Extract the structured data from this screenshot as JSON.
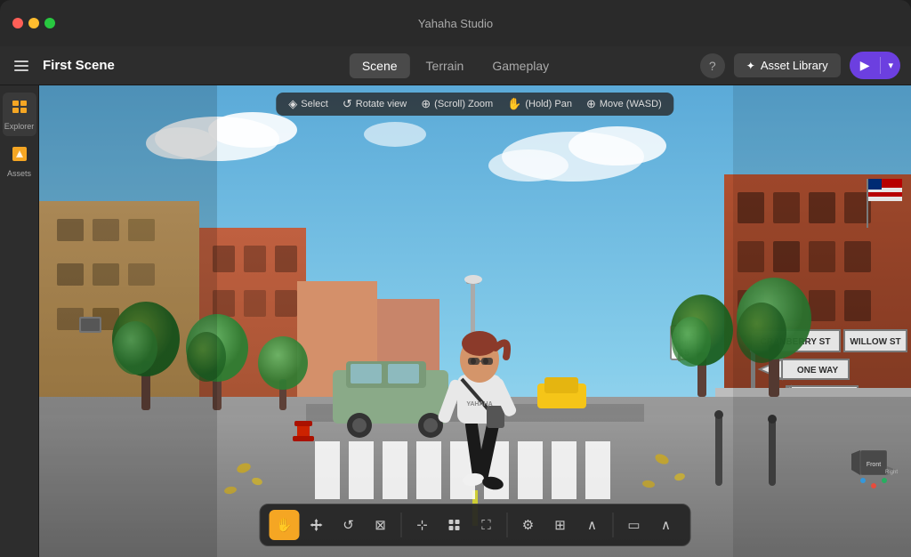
{
  "app": {
    "title": "Yahaha Studio"
  },
  "title_bar": {
    "traffic_lights": [
      "red",
      "yellow",
      "green"
    ]
  },
  "toolbar": {
    "scene_name": "First Scene",
    "tabs": [
      {
        "id": "scene",
        "label": "Scene",
        "active": true
      },
      {
        "id": "terrain",
        "label": "Terrain",
        "active": false
      },
      {
        "id": "gameplay",
        "label": "Gameplay",
        "active": false
      }
    ],
    "help_label": "?",
    "asset_library_label": "Asset Library",
    "play_label": "▶",
    "play_dropdown": "▾"
  },
  "sidebar": {
    "items": [
      {
        "id": "explorer",
        "label": "Explorer",
        "icon": "🗂"
      },
      {
        "id": "assets",
        "label": "Assets",
        "icon": "🟧"
      }
    ]
  },
  "viewport_toolbar": {
    "tools": [
      {
        "id": "select",
        "icon": "◈",
        "label": "Select"
      },
      {
        "id": "rotate",
        "icon": "↺",
        "label": "Rotate view"
      },
      {
        "id": "zoom",
        "icon": "⊕",
        "label": "(Scroll) Zoom"
      },
      {
        "id": "pan",
        "icon": "✋",
        "label": "(Hold) Pan"
      },
      {
        "id": "move",
        "icon": "⊕",
        "label": "Move (WASD)"
      }
    ]
  },
  "bottom_toolbar": {
    "buttons": [
      {
        "id": "hand",
        "icon": "✋",
        "active": true,
        "label": "Hand tool"
      },
      {
        "id": "move",
        "icon": "✛",
        "active": false,
        "label": "Move"
      },
      {
        "id": "rotate2",
        "icon": "↺",
        "active": false,
        "label": "Rotate"
      },
      {
        "id": "scale",
        "icon": "⊠",
        "active": false,
        "label": "Scale"
      },
      {
        "id": "transform",
        "icon": "⊹",
        "active": false,
        "label": "Transform"
      },
      {
        "id": "pivot",
        "icon": "⊕",
        "active": false,
        "label": "Pivot"
      },
      {
        "id": "expand",
        "icon": "⛶",
        "active": false,
        "label": "Expand"
      },
      {
        "id": "settings",
        "icon": "⚙",
        "active": false,
        "label": "Settings"
      },
      {
        "id": "grid",
        "icon": "⊞",
        "active": false,
        "label": "Grid"
      },
      {
        "id": "chevup",
        "icon": "∧",
        "active": false,
        "label": "Chevron up"
      },
      {
        "id": "camview",
        "icon": "▭",
        "active": false,
        "label": "Camera view"
      },
      {
        "id": "chevup2",
        "icon": "∧",
        "active": false,
        "label": "Chevron up 2"
      }
    ]
  },
  "gizmo": {
    "labels": {
      "front": "Front",
      "right": "Right"
    }
  }
}
